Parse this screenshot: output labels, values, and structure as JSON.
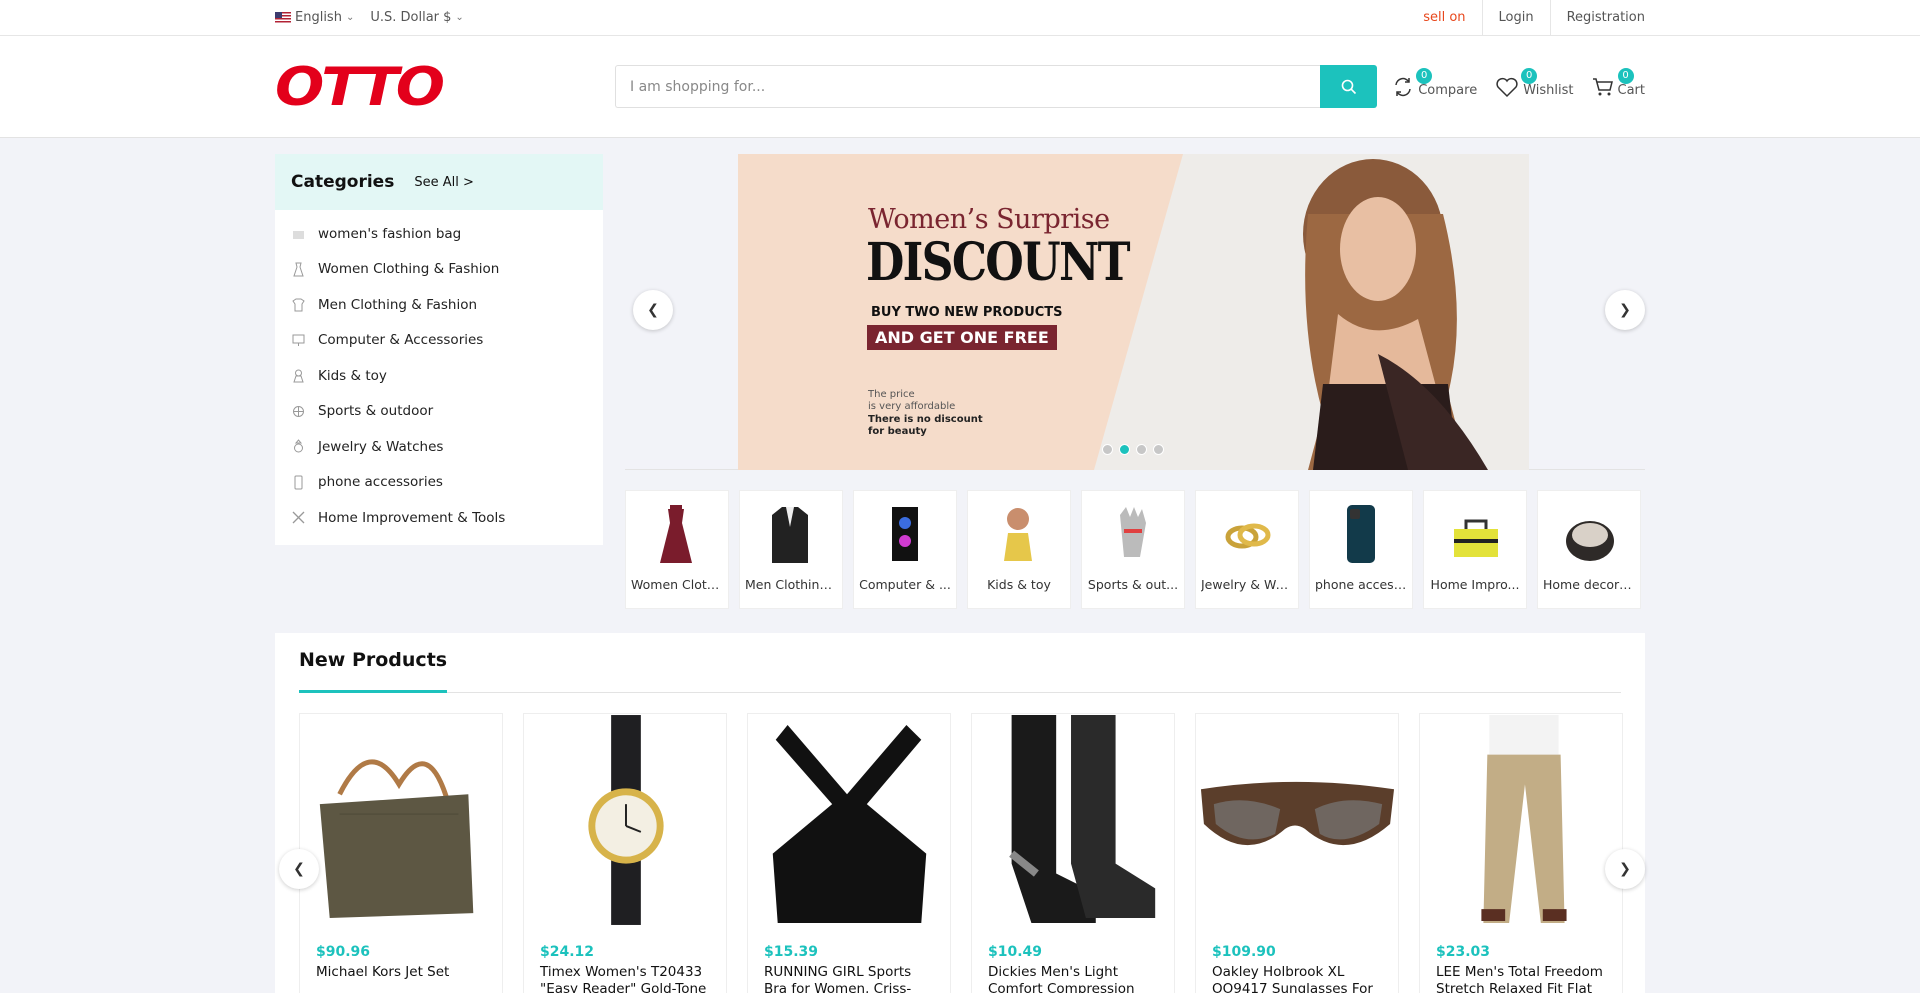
{
  "topbar": {
    "language": "English",
    "currency": "U.S. Dollar $",
    "sell_on": "sell on",
    "login": "Login",
    "registration": "Registration"
  },
  "header": {
    "logo": "OTTO",
    "search_placeholder": "I am shopping for...",
    "compare": {
      "label": "Compare",
      "count": "0"
    },
    "wishlist": {
      "label": "Wishlist",
      "count": "0"
    },
    "cart": {
      "label": "Cart",
      "count": "0"
    }
  },
  "categories": {
    "title": "Categories",
    "see_all": "See All >",
    "items": [
      {
        "label": "women's fashion bag",
        "icon": "bag-icon"
      },
      {
        "label": "Women Clothing & Fashion",
        "icon": "dress-icon"
      },
      {
        "label": "Men Clothing & Fashion",
        "icon": "shirt-icon"
      },
      {
        "label": "Computer & Accessories",
        "icon": "monitor-icon"
      },
      {
        "label": "Kids & toy",
        "icon": "toy-icon"
      },
      {
        "label": "Sports & outdoor",
        "icon": "sports-icon"
      },
      {
        "label": "Jewelry & Watches",
        "icon": "ring-icon"
      },
      {
        "label": "phone accessories",
        "icon": "phone-icon"
      },
      {
        "label": "Home Improvement & Tools",
        "icon": "tools-icon"
      }
    ]
  },
  "banner": {
    "line1": "Women’s Surprise",
    "line2": "DISCOUNT",
    "line3": "BUY TWO NEW PRODUCTS",
    "line4": "AND GET ONE FREE",
    "line5": "The price\nis very affordable",
    "line6": "There is no discount\nfor beauty",
    "active_dot": 1,
    "dots": 4
  },
  "category_cards": [
    {
      "label": "Women Cloth...",
      "icon": "dress-icon"
    },
    {
      "label": "Men Clothing...",
      "icon": "jacket-icon"
    },
    {
      "label": "Computer & ...",
      "icon": "pc-icon"
    },
    {
      "label": "Kids & toy",
      "icon": "toy-icon"
    },
    {
      "label": "Sports & out...",
      "icon": "glove-icon"
    },
    {
      "label": "Jewelry & Wa...",
      "icon": "ring-icon"
    },
    {
      "label": "phone access...",
      "icon": "phone-icon"
    },
    {
      "label": "Home Impro...",
      "icon": "toolbag-icon"
    },
    {
      "label": "Home decora...",
      "icon": "chair-icon"
    }
  ],
  "new_products": {
    "title": "New Products",
    "items": [
      {
        "price": "$90.96",
        "name": "Michael Kors Jet Set",
        "icon": "handbag-icon"
      },
      {
        "price": "$24.12",
        "name": "Timex Women's T20433 \"Easy Reader\" Gold-Tone",
        "icon": "watch-icon"
      },
      {
        "price": "$15.39",
        "name": "RUNNING GIRL Sports Bra for Women, Criss-Cross",
        "icon": "sports-bra-icon"
      },
      {
        "price": "$10.49",
        "name": "Dickies Men's Light Comfort Compression",
        "icon": "socks-icon"
      },
      {
        "price": "$109.90",
        "name": "Oakley Holbrook XL OO9417 Sunglasses For",
        "icon": "sunglasses-icon"
      },
      {
        "price": "$23.03",
        "name": "LEE Men's Total Freedom Stretch Relaxed Fit Flat",
        "icon": "pants-icon"
      }
    ]
  }
}
